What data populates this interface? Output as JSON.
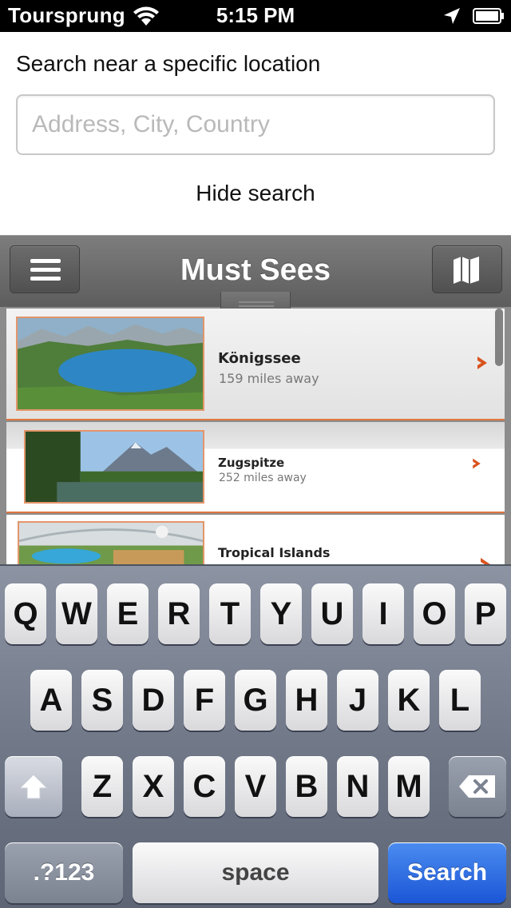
{
  "status_bar": {
    "carrier": "Toursprung",
    "time": "5:15 PM",
    "icons": [
      "wifi-icon",
      "location-arrow-icon",
      "battery-icon"
    ]
  },
  "search": {
    "heading": "Search near a specific location",
    "placeholder": "Address, City, Country",
    "value": "",
    "hide_label": "Hide search"
  },
  "navbar": {
    "title": "Must Sees",
    "left_icon": "menu-icon",
    "right_icon": "map-icon"
  },
  "list": {
    "items": [
      {
        "title": "Königssee",
        "distance": "159 miles away"
      },
      {
        "title": "Zugspitze",
        "distance": "252 miles away"
      },
      {
        "title": "Tropical Islands",
        "distance": ""
      }
    ]
  },
  "keyboard": {
    "row1": [
      "Q",
      "W",
      "E",
      "R",
      "T",
      "Y",
      "U",
      "I",
      "O",
      "P"
    ],
    "row2": [
      "A",
      "S",
      "D",
      "F",
      "G",
      "H",
      "J",
      "K",
      "L"
    ],
    "row3": [
      "Z",
      "X",
      "C",
      "V",
      "B",
      "N",
      "M"
    ],
    "numbers_label": ".?123",
    "space_label": "space",
    "search_label": "Search"
  },
  "colors": {
    "accent_orange": "#e0763c",
    "search_key_blue": "#1b56d6",
    "navbar_gray": "#6a6a6a"
  }
}
